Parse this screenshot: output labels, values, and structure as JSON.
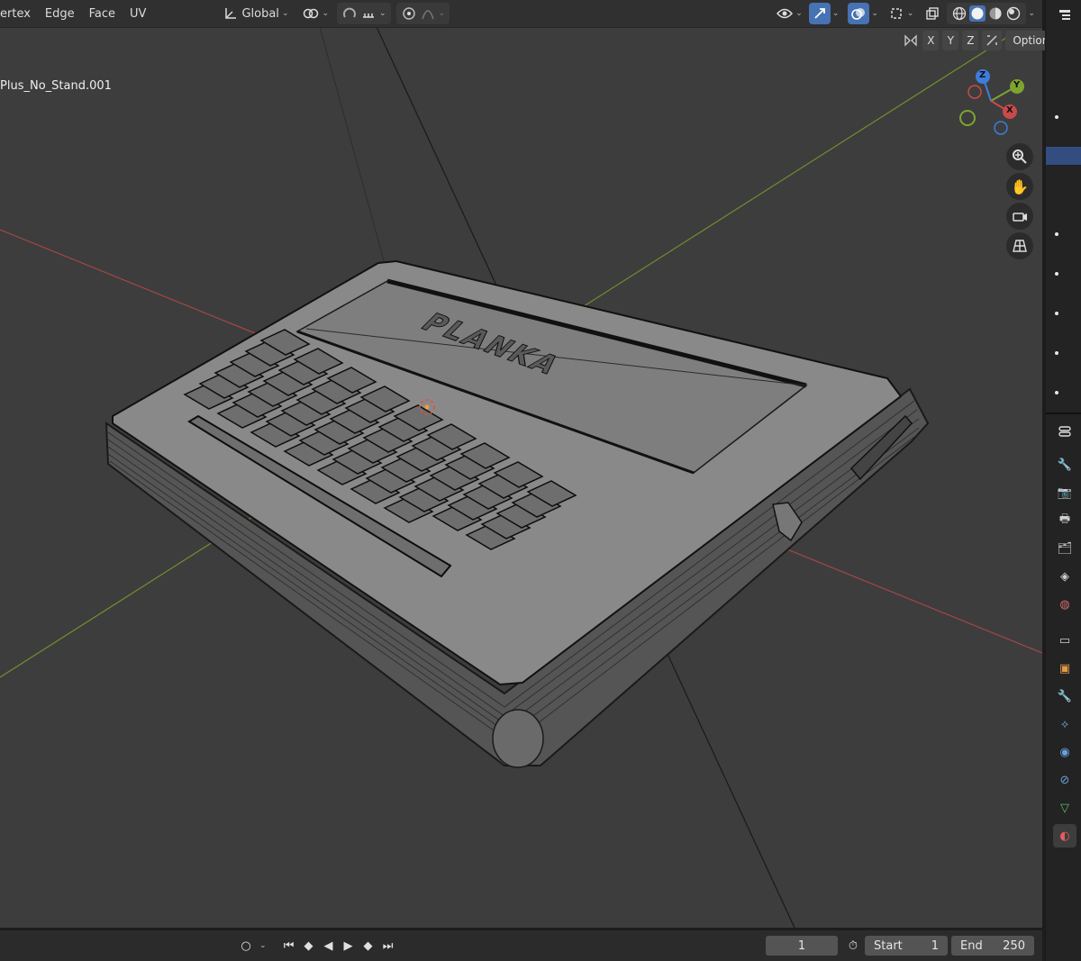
{
  "header": {
    "menus": [
      "ertex",
      "Edge",
      "Face",
      "UV"
    ],
    "orientation_label": "Global",
    "icons": [
      "transform-orientation-icon",
      "pivot-icon",
      "snap-icon",
      "proportional-edit-icon",
      "visibility-icon",
      "gizmo-icon",
      "overlay-icon",
      "xray-icon",
      "shading-wireframe-icon",
      "shading-solid-icon",
      "shading-material-icon",
      "shading-rendered-icon"
    ]
  },
  "options_row": {
    "axis_x": "X",
    "axis_y": "Y",
    "axis_z": "Z",
    "options_label": "Options"
  },
  "viewport": {
    "object_name": "Plus_No_Stand.001",
    "model_text": "PLANKA",
    "gizmo": {
      "x": "X",
      "y": "Y",
      "z": "Z"
    },
    "colors": {
      "x_axis": "#c94a4a",
      "y_axis": "#7ea32f",
      "z_axis": "#3e7ddc",
      "background": "#3d3d3d"
    }
  },
  "timeline": {
    "current_frame": "1",
    "start_label": "Start",
    "start_value": "1",
    "end_label": "End",
    "end_value": "250"
  },
  "properties_tabs": [
    "tool-icon",
    "render-icon",
    "output-icon",
    "view-layer-icon",
    "scene-icon",
    "world-icon",
    "collection-icon",
    "object-icon",
    "modifier-icon",
    "particles-icon",
    "physics-icon",
    "constraints-icon",
    "data-icon",
    "material-icon"
  ]
}
